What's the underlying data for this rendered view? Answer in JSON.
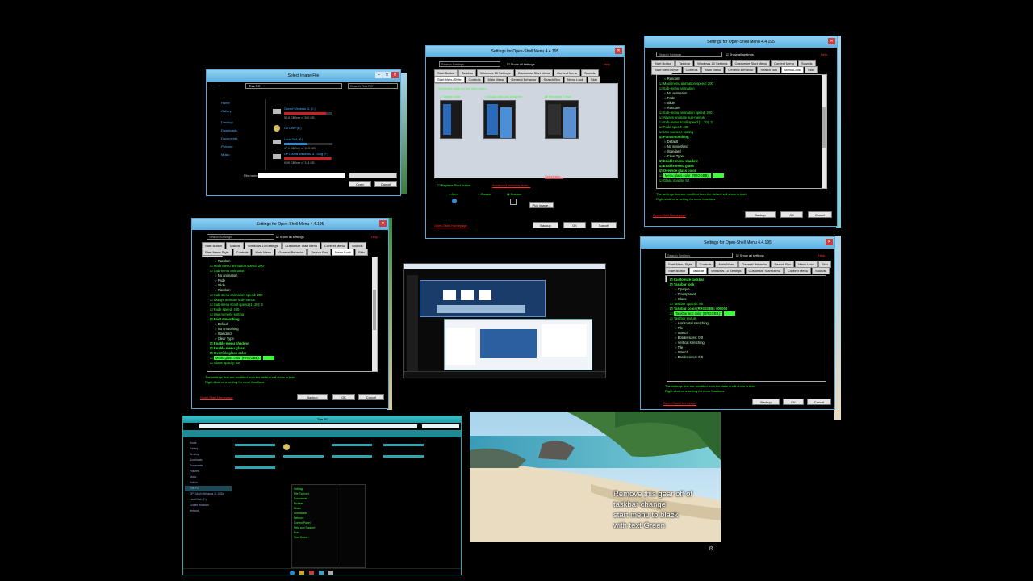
{
  "caption": {
    "lines": [
      "Remove this gear off of",
      "taskbar change",
      "start menu to black",
      "with text Green"
    ]
  },
  "image_file_dialog": {
    "title": "Select Image File",
    "address": "This PC",
    "search_placeholder": "Search This PC",
    "nav_items": [
      "Home",
      "Gallery",
      "Desktop",
      "Downloads",
      "Documents",
      "Pictures",
      "Music"
    ],
    "drives": [
      {
        "name": "Cloned Windows 11 (C:)",
        "free": "54.8 GB free of 390 GB",
        "fill": 0.86
      },
      {
        "name": "CD Drive (D:)",
        "free": "",
        "fill": 0
      },
      {
        "name": "Local Disk (E:)",
        "free": "47.1 GB free of 90.0 MB",
        "fill": 0.48
      },
      {
        "name": "OPT-MAIN Windows 11 10Gig (F:)",
        "free": "9.09 GB free of 314 GB",
        "fill": 0.97
      }
    ],
    "filename_label": "File name:",
    "open_label": "Open",
    "cancel_label": "Cancel"
  },
  "settings_start_style": {
    "title": "Settings for Open-Shell Menu 4.4.195",
    "search_placeholder": "Search Settings",
    "show_all_label": "Show all settings",
    "help_label": "Help...",
    "tabs_row1": [
      "Start Button",
      "Taskbar",
      "Windows 10 Settings",
      "Customize Start Menu",
      "Context Menu",
      "Sounds",
      "Language"
    ],
    "tabs_row2": [
      "Start Menu Style",
      "Controls",
      "Main Menu",
      "General Behavior",
      "Search Box",
      "Menu Look",
      "Skin"
    ],
    "prompt": "Select the style for the start menu:",
    "styles": [
      "Classic style",
      "Classic with two columns",
      "Windows 7 style"
    ],
    "select_skin": "Select skin...",
    "replace_start_button": "Replace Start button",
    "advanced_button_options": "Advanced button options...",
    "button_choices": [
      "Aero",
      "Classic",
      "Custom"
    ],
    "pick_image": "Pick image...",
    "homepage_link": "Open-Shell Homepage",
    "backup_label": "Backup",
    "ok_label": "OK",
    "cancel_label": "Cancel"
  },
  "settings_menu_look_a": {
    "title": "Settings for Open-Shell Menu 4.4.195",
    "search_placeholder": "Search Settings",
    "show_all_label": "Show all settings",
    "help_label": "Help...",
    "tabs_row1": [
      "Start Button",
      "Taskbar",
      "Windows 10 Settings",
      "Customize Start Menu",
      "Context Menu",
      "Sounds",
      "Language"
    ],
    "tabs_row2": [
      "Start Menu Style",
      "Controls",
      "Main Menu",
      "General Behavior",
      "Search Box",
      "Menu Look",
      "Skin"
    ],
    "items": [
      {
        "t": "Random",
        "c": "i1"
      },
      {
        "t": "Main menu animation speed: 200",
        "c": ""
      },
      {
        "t": "Sub-menu animation",
        "c": ""
      },
      {
        "t": "No animation",
        "c": "i1"
      },
      {
        "t": "Fade",
        "c": "i1"
      },
      {
        "t": "Slide",
        "c": "i1"
      },
      {
        "t": "Random",
        "c": "i1"
      },
      {
        "t": "Sub-menu animation speed: 200",
        "c": ""
      },
      {
        "t": "Always animate sub-menus",
        "c": ""
      },
      {
        "t": "Sub-menu scroll speed (1..10): 3",
        "c": ""
      },
      {
        "t": "Fade speed: 400",
        "c": ""
      },
      {
        "t": "Use numeric sorting",
        "c": ""
      },
      {
        "t": "Font smoothing",
        "c": "b"
      },
      {
        "t": "Default",
        "c": "i1"
      },
      {
        "t": "No smoothing",
        "c": "i1"
      },
      {
        "t": "Standard",
        "c": "i1"
      },
      {
        "t": "Clear Type",
        "c": "i1"
      },
      {
        "t": "Enable menu shadow",
        "c": "b"
      },
      {
        "t": "Enable menu glass",
        "c": "b"
      },
      {
        "t": "Override glass color",
        "c": "b"
      },
      {
        "t": "Menu glass color (RRGGBB):",
        "c": "hl"
      },
      {
        "t": "Glass opacity: 50",
        "c": ""
      }
    ],
    "note1": "The settings that are modified from the default will show in bold",
    "note2": "Right-click on a setting for more functions",
    "homepage_link": "Open-Shell Homepage",
    "backup_label": "Backup",
    "ok_label": "OK",
    "cancel_label": "Cancel"
  },
  "settings_menu_look_b": {
    "title": "Settings for Open-Shell Menu 4.4.195",
    "search_placeholder": "Search Settings",
    "show_all_label": "Show all settings",
    "help_label": "Help...",
    "tabs_row1": [
      "Start Button",
      "Taskbar",
      "Windows 10 Settings",
      "Customize Start Menu",
      "Context Menu",
      "Sounds",
      "Language"
    ],
    "tabs_row2": [
      "Start Menu Style",
      "Controls",
      "Main Menu",
      "General Behavior",
      "Search Box",
      "Menu Look",
      "Skin"
    ],
    "items": [
      {
        "t": "Random",
        "c": "i1"
      },
      {
        "t": "Main menu animation speed: 200",
        "c": ""
      },
      {
        "t": "Sub-menu animation",
        "c": ""
      },
      {
        "t": "No animation",
        "c": "i1"
      },
      {
        "t": "Fade",
        "c": "i1"
      },
      {
        "t": "Slide",
        "c": "i1"
      },
      {
        "t": "Random",
        "c": "i1"
      },
      {
        "t": "Sub-menu animation speed: 200",
        "c": ""
      },
      {
        "t": "Always animate sub-menus",
        "c": ""
      },
      {
        "t": "Sub-menu scroll speed (1..10): 3",
        "c": ""
      },
      {
        "t": "Fade speed: 400",
        "c": ""
      },
      {
        "t": "Use numeric sorting",
        "c": ""
      },
      {
        "t": "Font smoothing",
        "c": "b"
      },
      {
        "t": "Default",
        "c": "i1"
      },
      {
        "t": "No smoothing",
        "c": "i1"
      },
      {
        "t": "Standard",
        "c": "i1"
      },
      {
        "t": "Clear Type",
        "c": "i1"
      },
      {
        "t": "Enable menu shadow",
        "c": "b"
      },
      {
        "t": "Enable menu glass",
        "c": "b"
      },
      {
        "t": "Override glass color",
        "c": "b"
      },
      {
        "t": "Menu glass color (RRGGBB):",
        "c": "hl"
      },
      {
        "t": "Glass opacity: 50",
        "c": ""
      }
    ],
    "note1": "The settings that are modified from the default will show in bold",
    "note2": "Right-click on a setting for more functions",
    "homepage_link": "Open-Shell Homepage",
    "backup_label": "Backup",
    "ok_label": "OK",
    "cancel_label": "Cancel"
  },
  "settings_taskbar": {
    "title": "Settings for Open-Shell Menu 4.4.195",
    "search_placeholder": "Search Settings",
    "show_all_label": "Show all settings",
    "help_label": "Help...",
    "tabs_row1": [
      "Start Menu Style",
      "Controls",
      "Main Menu",
      "General Behavior",
      "Search Box",
      "Menu Look",
      "Skin"
    ],
    "tabs_row2": [
      "Start Button",
      "Taskbar",
      "Windows 10 Settings",
      "Customize Start Menu",
      "Context Menu",
      "Sounds",
      "Language"
    ],
    "items": [
      {
        "t": "Customize taskbar",
        "c": "b"
      },
      {
        "t": "Taskbar look",
        "c": "b"
      },
      {
        "t": "Opaque",
        "c": "i1"
      },
      {
        "t": "Transparent",
        "c": "i1"
      },
      {
        "t": "Glass",
        "c": "i1"
      },
      {
        "t": "Taskbar opacity: 85",
        "c": ""
      },
      {
        "t": "Taskbar color (RRGGBB): 000000",
        "c": "b"
      },
      {
        "t": "Taskbar text color (RRGGBB):",
        "c": "hl"
      },
      {
        "t": "Taskbar texture",
        "c": ""
      },
      {
        "t": "Horizontal stretching",
        "c": "i1"
      },
      {
        "t": "Tile",
        "c": "i1"
      },
      {
        "t": "Stretch",
        "c": "i1"
      },
      {
        "t": "Border sizes: 0,0",
        "c": "i1"
      },
      {
        "t": "Vertical stretching",
        "c": "i1"
      },
      {
        "t": "Tile",
        "c": "i1"
      },
      {
        "t": "Stretch",
        "c": "i1"
      },
      {
        "t": "Border sizes: 0,0",
        "c": "i1"
      }
    ],
    "note1": "The settings that are modified from the default will show in bold",
    "note2": "Right-click on a setting for more functions",
    "homepage_link": "Open-Shell Homepage",
    "backup_label": "Backup",
    "ok_label": "OK",
    "cancel_label": "Cancel"
  },
  "explorer": {
    "title": "This PC",
    "nav_items": [
      "Home",
      "Gallery",
      "Desktop",
      "Downloads",
      "Documents",
      "Pictures",
      "Music",
      "Videos",
      "This PC",
      "OPT-MAIN Windows 11 10Gig",
      "Local Disk (E:)",
      "Cloned Windows",
      "Network"
    ],
    "start_menu_items": [
      "Settings",
      "File Explorer",
      "Documents",
      "Pictures",
      "Music",
      "Downloads",
      "Network",
      "Control Panel",
      "Help and Support",
      "Run...",
      "Shut Down..."
    ]
  },
  "colors": {
    "green_text": "#3aff3a",
    "help_red": "#ff3030",
    "title_blue": "#6cbce8"
  }
}
